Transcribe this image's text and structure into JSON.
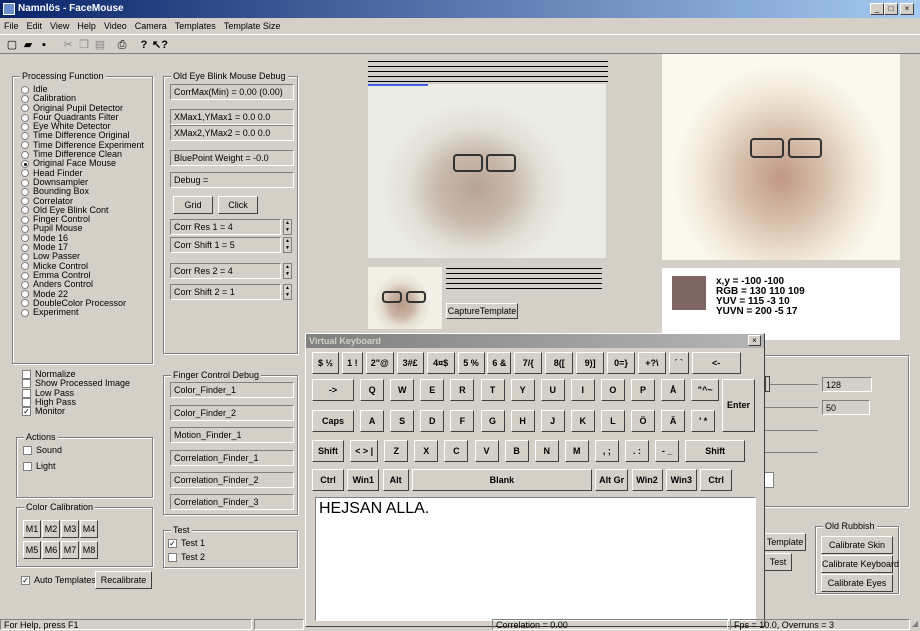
{
  "window": {
    "title": "Namnlös - FaceMouse",
    "min": "_",
    "max": "□",
    "close": "×"
  },
  "menu": [
    "File",
    "Edit",
    "View",
    "Help",
    "Video",
    "Camera",
    "Templates",
    "Template Size"
  ],
  "toolbar": {
    "icons": [
      "new-icon",
      "open-icon",
      "save-icon",
      "cut-icon",
      "copy-icon",
      "paste-icon",
      "print-icon",
      "help-icon",
      "context-help-icon"
    ]
  },
  "processing": {
    "title": "Processing Function",
    "items": [
      "Idle",
      "Calibration",
      "Original Pupil Detector",
      "Four Quadrants Filter",
      "Eye White Detector",
      "Time Difference Original",
      "Time Difference Experiment",
      "Time Difference Clean",
      "Original Face Mouse",
      "Head Finder",
      "Downsampler",
      "Bounding Box",
      "Correlator",
      "Old Eye Blink Cont",
      "Finger Control",
      "Pupil Mouse",
      "Mode 16",
      "Mode 17",
      "Low Passer",
      "Micke Control",
      "Emma Control",
      "Anders Control",
      "Mode 22",
      "DoubleColor Processor",
      "Experiment"
    ],
    "selected_index": 8
  },
  "filters": {
    "items": [
      "Normalize",
      "Show Processed Image",
      "Low Pass",
      "High Pass",
      "Monitor"
    ],
    "checked": [
      false,
      false,
      false,
      false,
      true
    ]
  },
  "actions": {
    "title": "Actions",
    "items": [
      "Sound",
      "Light"
    ]
  },
  "color_cal": {
    "title": "Color Calibration",
    "buttons": [
      "M1",
      "M2",
      "M3",
      "M4",
      "M5",
      "M6",
      "M7",
      "M8"
    ]
  },
  "auto_templates": {
    "label": "Auto Templates",
    "checked": true,
    "recalibrate": "Recalibrate"
  },
  "eye_debug": {
    "title": "Old Eye Blink Mouse Debug",
    "fields": [
      "CorrMax(Min) = 0.00 (0.00)",
      "XMax1,YMax1 = 0.0 0.0",
      "XMax2,YMax2 = 0.0 0.0",
      "BluePoint Weight = -0.0",
      "Debug ="
    ],
    "grid": "Grid",
    "click": "Click",
    "corr": [
      "Corr Res 1 = 4",
      "Corr Shift 1 = 5",
      "Corr Res 2 = 4",
      "Corr Shift 2 = 1"
    ]
  },
  "finger_debug": {
    "title": "Finger Control Debug",
    "fields": [
      "Color_Finder_1",
      "Color_Finder_2",
      "Motion_Finder_1",
      "Correlation_Finder_1",
      "Correlation_Finder_2",
      "Correlation_Finder_3"
    ]
  },
  "test": {
    "title": "Test",
    "items": [
      "Test 1",
      "Test 2"
    ],
    "checked": [
      true,
      false
    ]
  },
  "capture_template": "CaptureTemplate",
  "color_info": {
    "swatch": "#7f6864",
    "lines": [
      "x,y = -100 -100",
      "RGB = 130 110 109",
      "YUV = 115 -3 10",
      "YUVN = 200 -5 17"
    ]
  },
  "sliders": {
    "values": [
      "128",
      "50"
    ]
  },
  "partial_buttons": {
    "template": "Template",
    "test": "Test"
  },
  "old_rubbish": {
    "title": "Old Rubbish",
    "buttons": [
      "Calibrate Skin",
      "Calibrate Keyboard",
      "Calibrate Eyes"
    ]
  },
  "keyboard": {
    "title": "Virtual Keyboard",
    "close": "×",
    "row1": [
      "$ ½",
      "1 !",
      "2\"@",
      "3#£",
      "4¤$",
      "5 %",
      "6 &",
      "7/{",
      "8([",
      "9)]",
      "0=}",
      "+?\\",
      "´ `",
      "<-"
    ],
    "row2": [
      "->",
      "Q",
      "W",
      "E",
      "R",
      "T",
      "Y",
      "U",
      "I",
      "O",
      "P",
      "Å",
      "\"^~"
    ],
    "row3": [
      "Caps",
      "A",
      "S",
      "D",
      "F",
      "G",
      "H",
      "J",
      "K",
      "L",
      "Ö",
      "Ä",
      "' *"
    ],
    "enter": "Enter",
    "row4": [
      "Shift",
      "< > |",
      "Z",
      "X",
      "C",
      "V",
      "B",
      "N",
      "M",
      ", ;",
      ". :",
      "- _",
      "Shift"
    ],
    "row5": [
      "Ctrl",
      "Win1",
      "Alt",
      "Blank",
      "Alt Gr",
      "Win2",
      "Win3",
      "Ctrl"
    ],
    "text": "HEJSAN ALLA."
  },
  "status": {
    "help": "For Help, press F1",
    "corr": "Correlation = 0.00",
    "fps": "Fps = 10.0,  Overruns = 3"
  }
}
